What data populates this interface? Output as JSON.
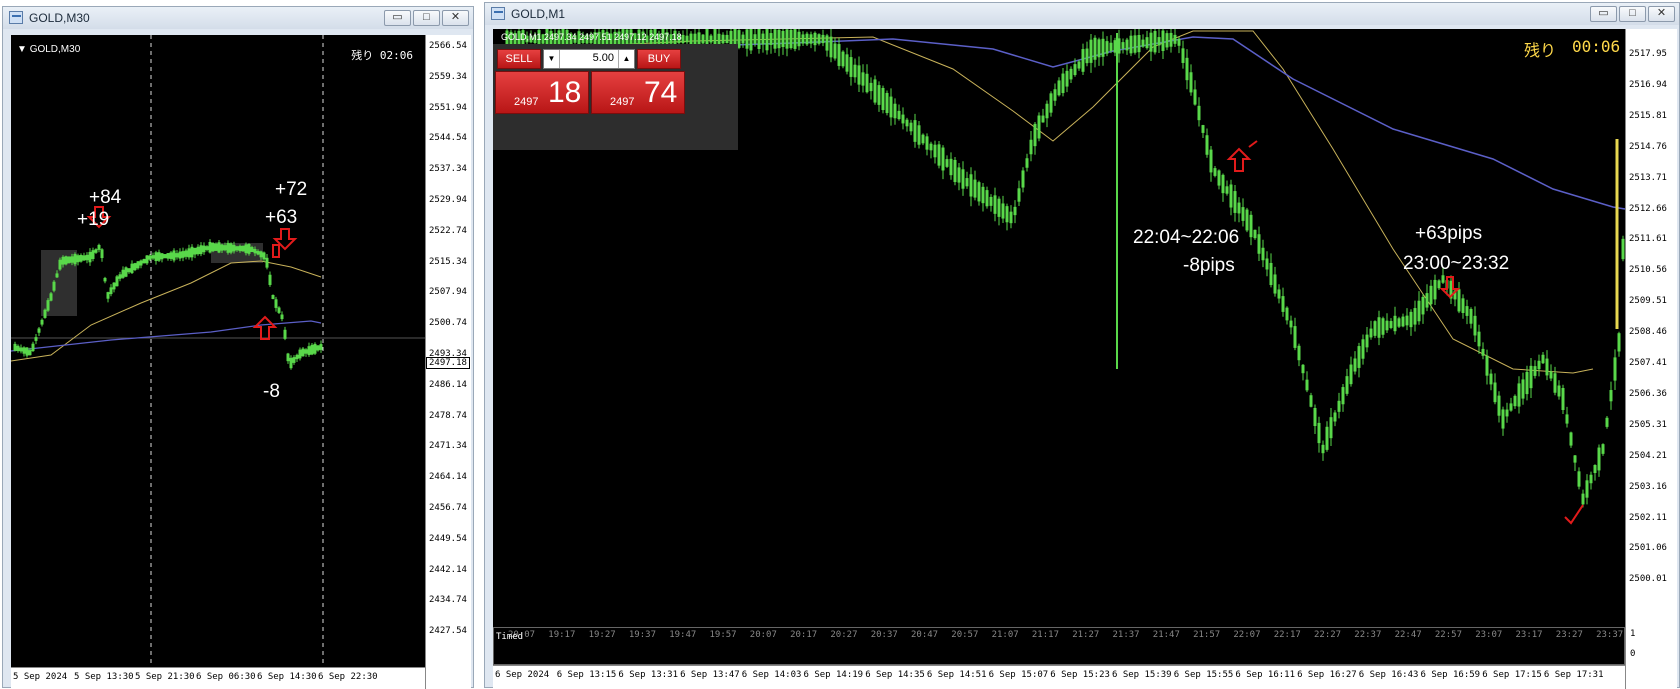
{
  "left": {
    "window_title": "GOLD,M30",
    "chart_label": "GOLD,M30",
    "remaining": "残り 02:06",
    "price_box": "2497.18",
    "y_ticks": [
      "2566.54",
      "2559.34",
      "2551.94",
      "2544.54",
      "2537.34",
      "2529.94",
      "2522.74",
      "2515.34",
      "2507.94",
      "2500.74",
      "2493.34",
      "2486.14",
      "2478.74",
      "2471.34",
      "2464.14",
      "2456.74",
      "2449.54",
      "2442.14",
      "2434.74",
      "2427.54"
    ],
    "x_ticks": [
      "5 Sep 2024",
      "5 Sep 13:30",
      "5 Sep 21:30",
      "6 Sep 06:30",
      "6 Sep 14:30",
      "6 Sep 22:30"
    ],
    "annotations": {
      "a1": "+84",
      "a2": "+19",
      "a3": "+72",
      "a4": "+63",
      "a5": "-8"
    },
    "arrow_color": "#e21b1b"
  },
  "right": {
    "window_title": "GOLD,M1",
    "header_text": "GOLD,M1  2497.34 2497.51 2497.12 2497.18",
    "remaining_label": "残り",
    "remaining_time": "00:06",
    "sell_label": "SELL",
    "buy_label": "BUY",
    "lot_value": "5.00",
    "sell_big": "18",
    "sell_small": "2497",
    "buy_big": "74",
    "buy_small": "2497",
    "y_ticks": [
      "2517.95",
      "2516.94",
      "2515.81",
      "2514.76",
      "2513.71",
      "2512.66",
      "2511.61",
      "2510.56",
      "2509.51",
      "2508.46",
      "2507.41",
      "2506.36",
      "2505.31",
      "2504.21",
      "2503.16",
      "2502.11",
      "2501.06",
      "2500.01"
    ],
    "x_ticks": [
      "6 Sep 2024",
      "6 Sep 13:15",
      "6 Sep 13:31",
      "6 Sep 13:47",
      "6 Sep 14:03",
      "6 Sep 14:19",
      "6 Sep 14:35",
      "6 Sep 14:51",
      "6 Sep 15:07",
      "6 Sep 15:23",
      "6 Sep 15:39",
      "6 Sep 15:55",
      "6 Sep 16:11",
      "6 Sep 16:27",
      "6 Sep 16:43",
      "6 Sep 16:59",
      "6 Sep 17:15",
      "6 Sep 17:31"
    ],
    "sub_ticks": [
      "20:07",
      "19:17",
      "19:27",
      "19:37",
      "19:47",
      "19:57",
      "20:07",
      "20:17",
      "20:27",
      "20:37",
      "20:47",
      "20:57",
      "21:07",
      "21:17",
      "21:27",
      "21:37",
      "21:47",
      "21:57",
      "22:07",
      "22:17",
      "22:27",
      "22:37",
      "22:47",
      "22:57",
      "23:07",
      "23:17",
      "23:27",
      "23:37"
    ],
    "sub_label": "Timed",
    "sub_axis": [
      "1",
      "0"
    ],
    "annotations": {
      "t1": "22:04~22:06",
      "t2": "-8pips",
      "t3": "+63pips",
      "t4": "23:00~23:32"
    },
    "candle_color": "#59d84a",
    "ma_yellow": "#c8b25a",
    "ma_blue": "#5b5fc7"
  }
}
